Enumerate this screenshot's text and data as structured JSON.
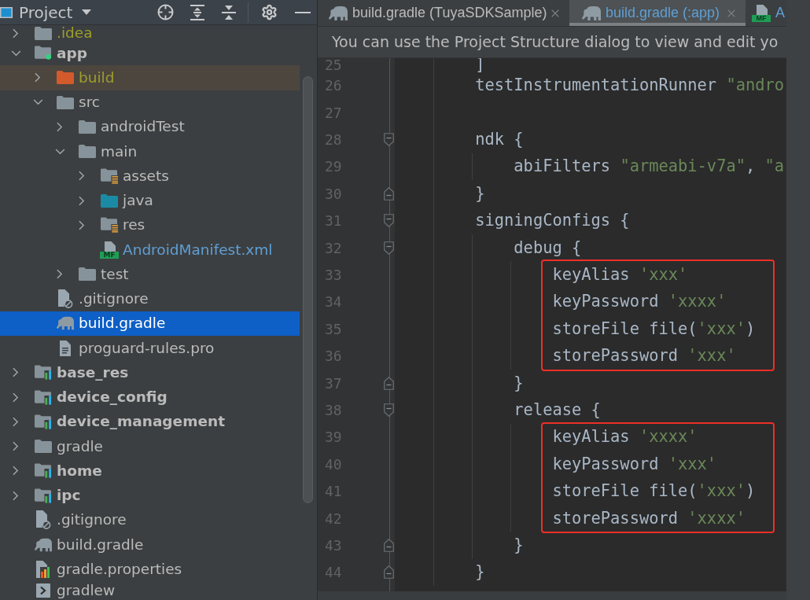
{
  "project_panel": {
    "title": "Project",
    "tree": [
      {
        "label": ".idea",
        "kind": "folder",
        "ignored": true,
        "modified": false,
        "expanded": false,
        "selected": false
      },
      {
        "label": "app",
        "kind": "app-module",
        "ignored": false,
        "modified": false,
        "expanded": true,
        "selected": false,
        "children": [
          {
            "label": "build",
            "kind": "excluded-folder",
            "ignored": true,
            "modified": false,
            "expanded": false,
            "selected": false
          },
          {
            "label": "src",
            "kind": "folder",
            "ignored": false,
            "modified": false,
            "expanded": true,
            "selected": false,
            "children": [
              {
                "label": "androidTest",
                "kind": "folder",
                "ignored": false,
                "modified": false,
                "expanded": false,
                "selected": false
              },
              {
                "label": "main",
                "kind": "folder",
                "ignored": false,
                "modified": false,
                "expanded": true,
                "selected": false,
                "children": [
                  {
                    "label": "assets",
                    "kind": "resource-folder",
                    "ignored": false,
                    "modified": false,
                    "expanded": false,
                    "selected": false
                  },
                  {
                    "label": "java",
                    "kind": "source-folder",
                    "ignored": false,
                    "modified": false,
                    "expanded": false,
                    "selected": false
                  },
                  {
                    "label": "res",
                    "kind": "resource-folder",
                    "ignored": false,
                    "modified": false,
                    "expanded": false,
                    "selected": false
                  },
                  {
                    "label": "AndroidManifest.xml",
                    "kind": "manifest",
                    "badge": "MF",
                    "ignored": false,
                    "modified": true,
                    "selected": false
                  }
                ]
              },
              {
                "label": "test",
                "kind": "folder",
                "ignored": false,
                "modified": false,
                "expanded": false,
                "selected": false
              }
            ]
          },
          {
            "label": ".gitignore",
            "kind": "gitignore",
            "ignored": false,
            "modified": false,
            "selected": false
          },
          {
            "label": "build.gradle",
            "kind": "gradle",
            "ignored": false,
            "modified": false,
            "selected": true
          },
          {
            "label": "proguard-rules.pro",
            "kind": "text-file",
            "ignored": false,
            "modified": false,
            "selected": false
          }
        ]
      },
      {
        "label": "base_res",
        "kind": "library-module",
        "ignored": false,
        "modified": false,
        "expanded": false,
        "selected": false
      },
      {
        "label": "device_config",
        "kind": "library-module",
        "ignored": false,
        "modified": false,
        "expanded": false,
        "selected": false
      },
      {
        "label": "device_management",
        "kind": "library-module",
        "ignored": false,
        "modified": false,
        "expanded": false,
        "selected": false
      },
      {
        "label": "gradle",
        "kind": "folder",
        "ignored": false,
        "modified": false,
        "expanded": false,
        "selected": false
      },
      {
        "label": "home",
        "kind": "library-module",
        "ignored": false,
        "modified": false,
        "expanded": false,
        "selected": false
      },
      {
        "label": "ipc",
        "kind": "library-module",
        "ignored": false,
        "modified": false,
        "expanded": false,
        "selected": false
      },
      {
        "label": ".gitignore",
        "kind": "gitignore",
        "ignored": false,
        "modified": false,
        "selected": false
      },
      {
        "label": "build.gradle",
        "kind": "gradle",
        "ignored": false,
        "modified": false,
        "selected": false
      },
      {
        "label": "gradle.properties",
        "kind": "properties",
        "ignored": false,
        "modified": false,
        "selected": false
      },
      {
        "label": "gradlew",
        "kind": "script",
        "ignored": false,
        "modified": false,
        "selected": false
      }
    ]
  },
  "editor": {
    "tabs": [
      {
        "label": "build.gradle (TuyaSDKSample)",
        "kind": "gradle",
        "modified": false,
        "selected": false
      },
      {
        "label": "build.gradle (:app)",
        "kind": "gradle",
        "modified": true,
        "selected": true
      },
      {
        "label": "A",
        "kind": "manifest",
        "badge": "MF",
        "modified": true,
        "selected": false
      }
    ],
    "notification": {
      "text": "You can use the Project Structure dialog to view and edit yo"
    },
    "lines": [
      {
        "number": "25",
        "tokens": [
          {
            "kind": "plain",
            "text": "        ]"
          }
        ],
        "fold_start": false,
        "fold_end": false,
        "boxed": false
      },
      {
        "number": "26",
        "tokens": [
          {
            "kind": "plain",
            "text": "        testInstrumentationRunner "
          },
          {
            "kind": "string",
            "text": "\"andro"
          }
        ],
        "fold_start": false,
        "fold_end": false,
        "boxed": false
      },
      {
        "number": "27",
        "fold_start": false,
        "fold_end": false,
        "boxed": false
      },
      {
        "number": "28",
        "tokens": [
          {
            "kind": "plain",
            "text": "        ndk {"
          }
        ],
        "fold_start": true,
        "fold_end": false,
        "boxed": false
      },
      {
        "number": "29",
        "tokens": [
          {
            "kind": "plain",
            "text": "            abiFilters "
          },
          {
            "kind": "string",
            "text": "\"armeabi-v7a\""
          },
          {
            "kind": "plain",
            "text": ", "
          },
          {
            "kind": "string",
            "text": "\"a"
          }
        ],
        "fold_start": false,
        "fold_end": false,
        "boxed": false
      },
      {
        "number": "30",
        "tokens": [
          {
            "kind": "plain",
            "text": "        }"
          }
        ],
        "fold_start": false,
        "fold_end": true,
        "boxed": false
      },
      {
        "number": "31",
        "tokens": [
          {
            "kind": "plain",
            "text": "        signingConfigs {"
          }
        ],
        "fold_start": true,
        "fold_end": false,
        "boxed": false
      },
      {
        "number": "32",
        "tokens": [
          {
            "kind": "plain",
            "text": "            debug {"
          }
        ],
        "fold_start": true,
        "fold_end": false,
        "boxed": false
      },
      {
        "number": "33",
        "tokens": [
          {
            "kind": "plain",
            "text": "                keyAlias "
          },
          {
            "kind": "string",
            "text": "'xxx'"
          }
        ],
        "fold_start": false,
        "fold_end": false,
        "boxed": true
      },
      {
        "number": "34",
        "tokens": [
          {
            "kind": "plain",
            "text": "                keyPassword "
          },
          {
            "kind": "string",
            "text": "'xxxx'"
          }
        ],
        "fold_start": false,
        "fold_end": false,
        "boxed": true
      },
      {
        "number": "35",
        "tokens": [
          {
            "kind": "plain",
            "text": "                storeFile file("
          },
          {
            "kind": "string",
            "text": "'xxx'"
          },
          {
            "kind": "plain",
            "text": ")"
          }
        ],
        "fold_start": false,
        "fold_end": false,
        "boxed": true
      },
      {
        "number": "36",
        "tokens": [
          {
            "kind": "plain",
            "text": "                storePassword "
          },
          {
            "kind": "string",
            "text": "'xxx'"
          }
        ],
        "fold_start": false,
        "fold_end": false,
        "boxed": true
      },
      {
        "number": "37",
        "tokens": [
          {
            "kind": "plain",
            "text": "            }"
          }
        ],
        "fold_start": false,
        "fold_end": true,
        "boxed": false
      },
      {
        "number": "38",
        "tokens": [
          {
            "kind": "plain",
            "text": "            release {"
          }
        ],
        "fold_start": true,
        "fold_end": false,
        "boxed": false
      },
      {
        "number": "39",
        "tokens": [
          {
            "kind": "plain",
            "text": "                keyAlias "
          },
          {
            "kind": "string",
            "text": "'xxxx'"
          }
        ],
        "fold_start": false,
        "fold_end": false,
        "boxed": true
      },
      {
        "number": "40",
        "tokens": [
          {
            "kind": "plain",
            "text": "                keyPassword "
          },
          {
            "kind": "string",
            "text": "'xxx'"
          }
        ],
        "fold_start": false,
        "fold_end": false,
        "boxed": true
      },
      {
        "number": "41",
        "tokens": [
          {
            "kind": "plain",
            "text": "                storeFile file("
          },
          {
            "kind": "string",
            "text": "'xxx'"
          },
          {
            "kind": "plain",
            "text": ")"
          }
        ],
        "fold_start": false,
        "fold_end": false,
        "boxed": true
      },
      {
        "number": "42",
        "tokens": [
          {
            "kind": "plain",
            "text": "                storePassword "
          },
          {
            "kind": "string",
            "text": "'xxxx'"
          }
        ],
        "fold_start": false,
        "fold_end": false,
        "boxed": true
      },
      {
        "number": "43",
        "tokens": [
          {
            "kind": "plain",
            "text": "            }"
          }
        ],
        "fold_start": false,
        "fold_end": true,
        "boxed": false
      },
      {
        "number": "44",
        "tokens": [
          {
            "kind": "plain",
            "text": "        }"
          }
        ],
        "fold_start": false,
        "fold_end": true,
        "boxed": false
      }
    ]
  }
}
